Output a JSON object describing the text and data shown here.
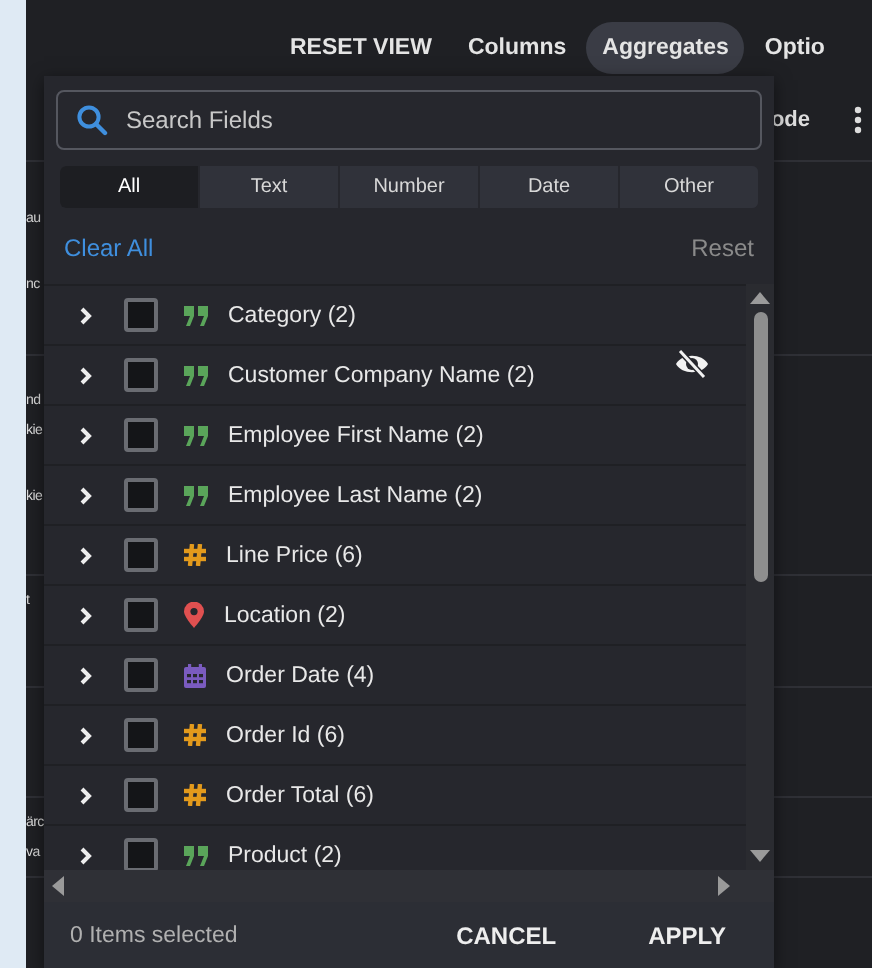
{
  "toolbar": [
    {
      "label": "RESET VIEW",
      "selected": false
    },
    {
      "label": "Columns",
      "selected": false
    },
    {
      "label": "Aggregates",
      "selected": true
    },
    {
      "label": "Optio",
      "selected": false
    }
  ],
  "background_table": {
    "header_text": "ode",
    "rows": [
      [
        "au",
        "nc"
      ],
      [
        "nd",
        "kie",
        "kie"
      ],
      [
        "t"
      ],
      [],
      [
        "ärc",
        "va"
      ]
    ]
  },
  "panel": {
    "search": {
      "placeholder": "Search Fields"
    },
    "filters": [
      {
        "label": "All",
        "selected": true
      },
      {
        "label": "Text",
        "selected": false
      },
      {
        "label": "Number",
        "selected": false
      },
      {
        "label": "Date",
        "selected": false
      },
      {
        "label": "Other",
        "selected": false
      }
    ],
    "clear_all": "Clear All",
    "reset": "Reset",
    "fields": [
      {
        "kind": "text",
        "label": "Category (2)",
        "checked": false,
        "expanded": false,
        "hide_icon": false
      },
      {
        "kind": "text",
        "label": "Customer Company Name (2)",
        "checked": false,
        "expanded": false,
        "hide_icon": true
      },
      {
        "kind": "text",
        "label": "Employee First Name (2)",
        "checked": false,
        "expanded": false,
        "hide_icon": false
      },
      {
        "kind": "text",
        "label": "Employee Last Name (2)",
        "checked": false,
        "expanded": false,
        "hide_icon": false
      },
      {
        "kind": "number",
        "label": "Line Price (6)",
        "checked": false,
        "expanded": false,
        "hide_icon": false
      },
      {
        "kind": "location",
        "label": "Location (2)",
        "checked": false,
        "expanded": false,
        "hide_icon": false
      },
      {
        "kind": "date",
        "label": "Order Date (4)",
        "checked": false,
        "expanded": false,
        "hide_icon": false
      },
      {
        "kind": "number",
        "label": "Order Id (6)",
        "checked": false,
        "expanded": false,
        "hide_icon": false
      },
      {
        "kind": "number",
        "label": "Order Total (6)",
        "checked": false,
        "expanded": false,
        "hide_icon": false
      },
      {
        "kind": "text",
        "label": "Product (2)",
        "checked": false,
        "expanded": false,
        "hide_icon": false
      }
    ],
    "footer": {
      "status": "0 Items selected",
      "cancel": "CANCEL",
      "apply": "APPLY"
    }
  }
}
